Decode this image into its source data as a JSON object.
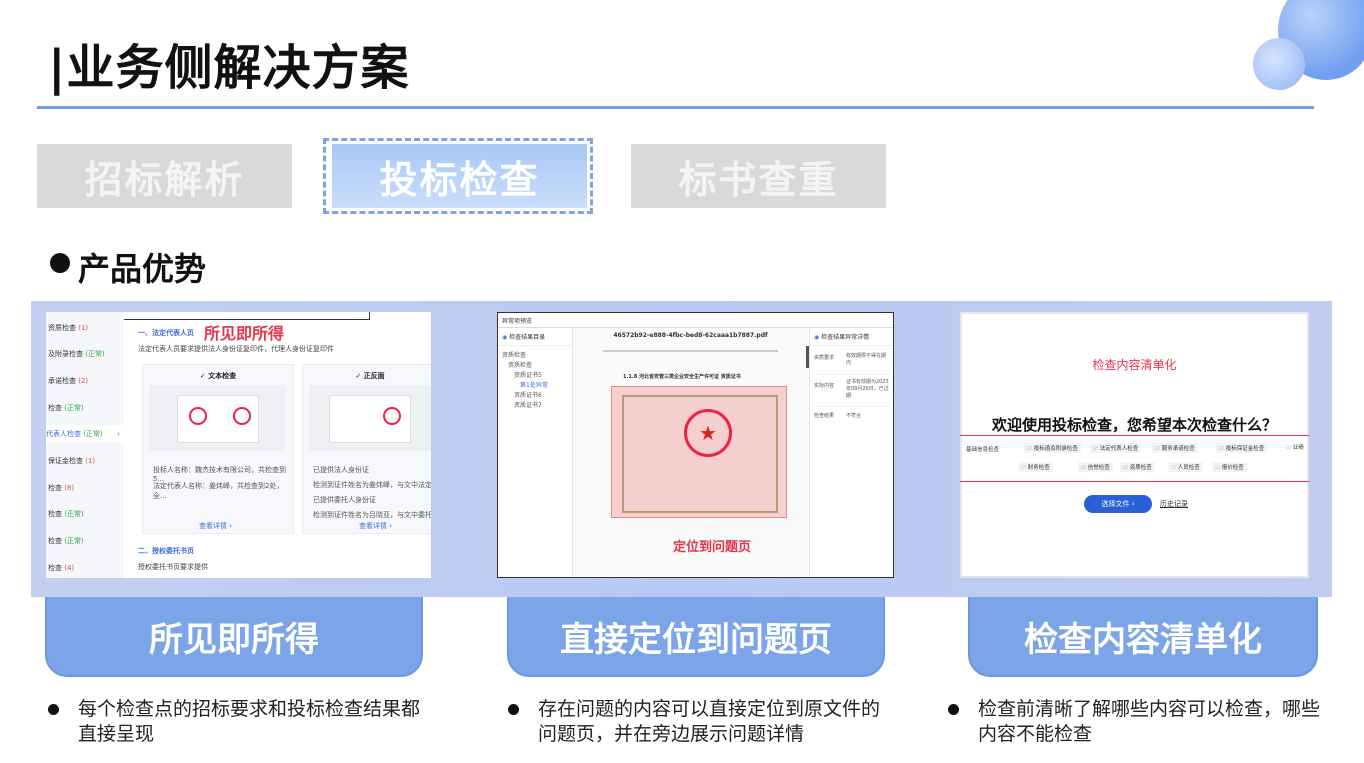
{
  "header": {
    "title": "|业务侧解决方案"
  },
  "tabs": [
    {
      "label": "招标解析",
      "active": false
    },
    {
      "label": "投标检查",
      "active": true
    },
    {
      "label": "标书查重",
      "active": false
    }
  ],
  "section": {
    "title": "产品优势"
  },
  "colors": {
    "accent": "#7ba5e8",
    "rule": "#6f9fe0",
    "band": "#c3cff0",
    "inactive_tab": "#d9d9d9"
  },
  "shot1": {
    "sidebar": [
      {
        "label": "资质检查",
        "badge": "(1)",
        "status": "warn"
      },
      {
        "label": "及附录检查",
        "badge": "(正常)",
        "status": "ok"
      },
      {
        "label": "承诺检查",
        "badge": "(2)",
        "status": "warn"
      },
      {
        "label": "检查",
        "badge": "(正常)",
        "status": "ok"
      },
      {
        "label": "代表人检查",
        "badge": "(正常)",
        "status": "ok"
      },
      {
        "label": "保证金检查",
        "badge": "(1)",
        "status": "warn"
      },
      {
        "label": "检查",
        "badge": "(8)",
        "status": "warn"
      },
      {
        "label": "检查",
        "badge": "(正常)",
        "status": "ok"
      },
      {
        "label": "检查",
        "badge": "(正常)",
        "status": "ok"
      },
      {
        "label": "检查",
        "badge": "(4)",
        "status": "warn"
      }
    ],
    "overlay": "所见即所得",
    "section1": "一、法定代表人页",
    "section1_desc": "法定代表人员要求提供法人身份证复印件，代理人身份证复印件",
    "card_left_title": "✓ 文本检查",
    "card_right_title": "✓ 正反面",
    "left_lines": [
      "投标人名称：魏杰技术有限公司，共检查到5...",
      "法定代表人名称：姜炜峰，共检查到2处，全..."
    ],
    "right_lines": [
      "已提供法人身份证",
      "检测到证件姓名为姜炜峰，与文中法定代表...",
      "已提供委托人身份证",
      "检测到证件姓名为吕晓亚，与文中委托人姓..."
    ],
    "detail_link": "查看详情 ›",
    "section2": "二、授权委托书页",
    "section2_desc": "授权委托书页要求提供"
  },
  "shot2": {
    "window_title": "异常项预览",
    "left_header": "检查结果目录",
    "tree": [
      "资质检查",
      "资质检查",
      "资质证书5",
      "第1处异常",
      "资质证书6",
      "资质证书7"
    ],
    "file_name": "46572b92-e888-4fbc-bed8-62caaa1b7887.pdf",
    "doc_heading": "1.1.8 河北省安管三类企业安全生产许可证 资质证书",
    "overlay": "定位到问题页",
    "right_header": "检查结果异常详情",
    "details": [
      {
        "k": "资质要求",
        "v": "有效期限不得在期内"
      },
      {
        "k": "实际内容",
        "v": "证书有效期为2023年09月20日，已过期"
      },
      {
        "k": "检查结果",
        "v": "不符合"
      }
    ]
  },
  "shot3": {
    "heading": "检查内容清单化",
    "welcome": "欢迎使用投标检查，您希望本次检查什么？",
    "row1": [
      "基础信息检查",
      "投标函及附录检查",
      "法定代表人检查",
      "服务承诺检查",
      "投标保证金检查",
      "业绩"
    ],
    "row2": [
      "财务检查",
      "信誉检查",
      "资质检查",
      "人员检查",
      "报价检查"
    ],
    "button": "选择文件 ›",
    "history": "历史记录"
  },
  "features": [
    {
      "title": "所见即所得",
      "desc": "每个检查点的招标要求和投标检查结果都直接呈现"
    },
    {
      "title": "直接定位到问题页",
      "desc": "存在问题的内容可以直接定位到原文件的问题页，并在旁边展示问题详情"
    },
    {
      "title": "检查内容清单化",
      "desc": "检查前清晰了解哪些内容可以检查，哪些内容不能检查"
    }
  ]
}
